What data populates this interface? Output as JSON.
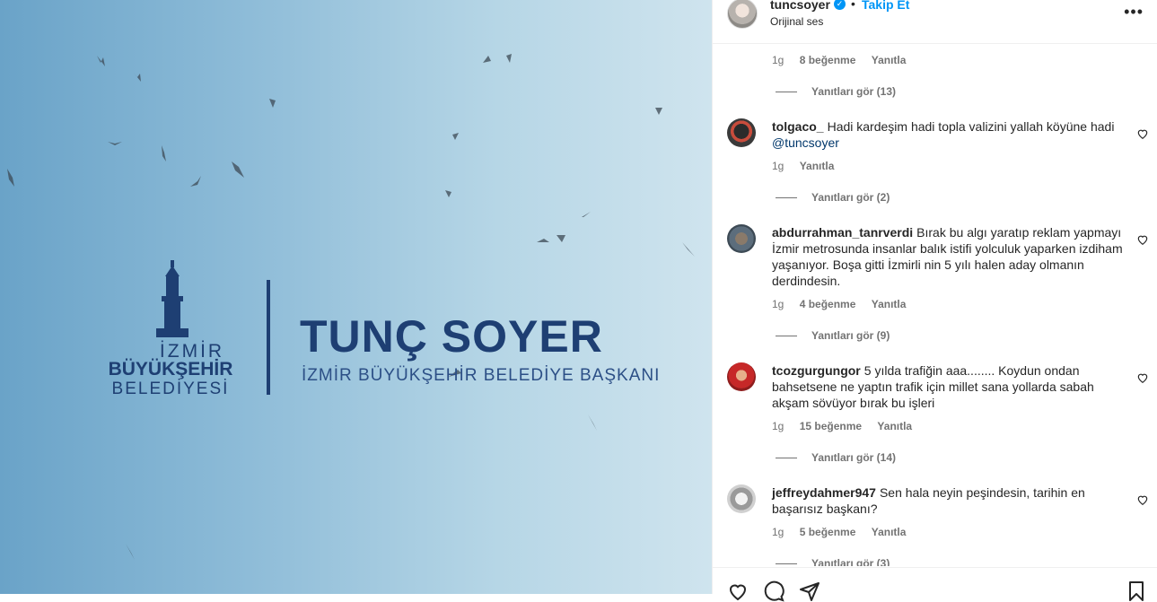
{
  "media": {
    "logo_top": "İZMİR",
    "logo_middle": "BÜYÜKŞEHİR",
    "logo_bottom": "BELEDİYESİ",
    "name": "TUNÇ SOYER",
    "subtitle": "İZMİR BÜYÜKŞEHİR BELEDİYE BAŞKANI",
    "colors": {
      "sky_left": "#6aa3c8",
      "sky_right": "#cfe4ee",
      "brand": "#1e3f73"
    }
  },
  "header": {
    "username": "tuncsoyer",
    "verified_icon": "verified-badge-icon",
    "separator": "•",
    "follow_label": "Takip Et",
    "audio_label": "Orijinal ses",
    "more_icon": "more-options-icon"
  },
  "first_comment_meta": {
    "time": "1g",
    "likes": "8 beğenme",
    "reply": "Yanıtla"
  },
  "first_comment_replies": "Yanıtları gör (13)",
  "comments": [
    {
      "username": "tolgaco_",
      "text": "Hadi kardeşim hadi topla valizini yallah köyüne hadi",
      "mention": "@tuncsoyer",
      "time": "1g",
      "likes": "",
      "reply": "Yanıtla",
      "replies": "Yanıtları gör (2)"
    },
    {
      "username": "abdurrahman_tanrverdi",
      "text": "Bırak bu algı yaratıp reklam yapmayı İzmir metrosunda insanlar balık istifi yolculuk yaparken izdiham yaşanıyor. Boşa gitti İzmirli nin 5 yılı halen aday olmanın derdindesin.",
      "time": "1g",
      "likes": "4 beğenme",
      "reply": "Yanıtla",
      "replies": "Yanıtları gör (9)"
    },
    {
      "username": "tcozgurgungor",
      "text": "5 yılda trafiğin aaa........ Koydun ondan bahsetsene ne yaptın trafik için millet sana yollarda sabah akşam sövüyor bırak bu işleri",
      "time": "1g",
      "likes": "15 beğenme",
      "reply": "Yanıtla",
      "replies": "Yanıtları gör (14)"
    },
    {
      "username": "jeffreydahmer947",
      "text": "Sen hala neyin peşindesin, tarihin en başarısız başkanı?",
      "time": "1g",
      "likes": "5 beğenme",
      "reply": "Yanıtla",
      "replies": "Yanıtları gör (3)"
    }
  ],
  "actions": {
    "like_icon": "heart-icon",
    "comment_icon": "comment-icon",
    "share_icon": "send-icon",
    "save_icon": "bookmark-icon"
  }
}
